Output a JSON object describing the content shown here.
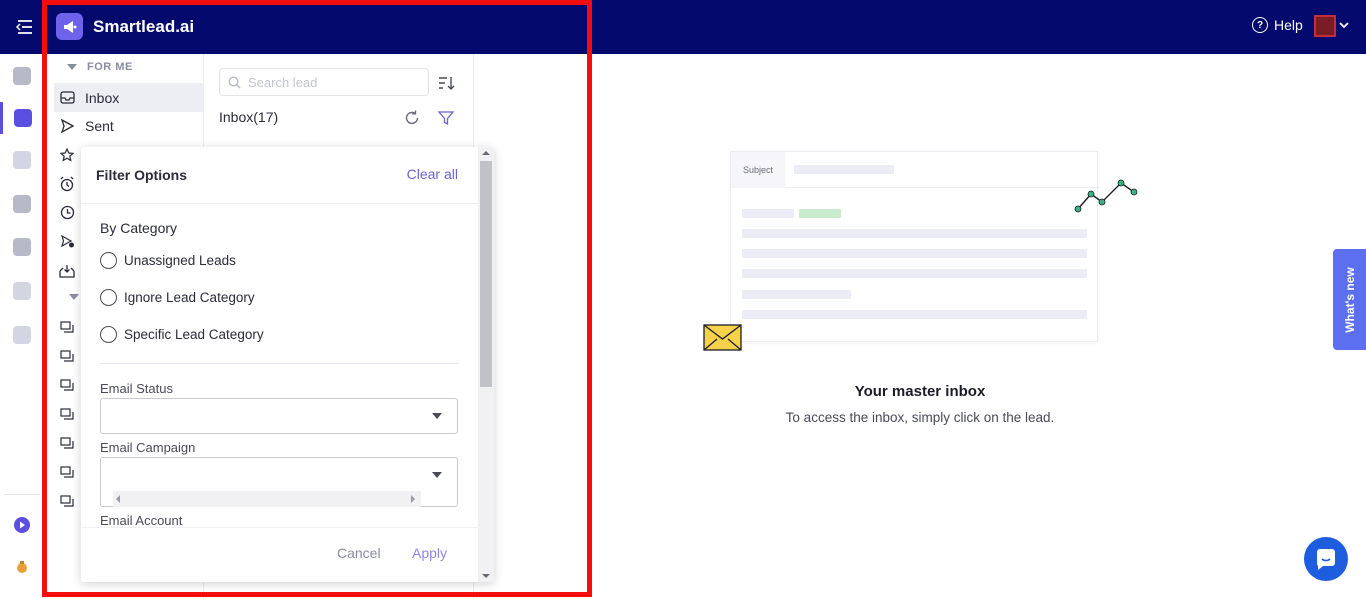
{
  "app": {
    "brand": "Smartlead.ai"
  },
  "topbar": {
    "help_label": "Help"
  },
  "folders": {
    "section_label": "FOR ME",
    "items": [
      {
        "label": "Inbox",
        "icon": "inbox-icon"
      },
      {
        "label": "Sent",
        "icon": "send-icon"
      }
    ]
  },
  "list": {
    "search_placeholder": "Search lead",
    "inbox_title": "Inbox(17)"
  },
  "filter": {
    "title": "Filter Options",
    "clear_all": "Clear all",
    "by_category": "By Category",
    "categories": [
      "Unassigned Leads",
      "Ignore Lead Category",
      "Specific Lead Category"
    ],
    "email_status_label": "Email Status",
    "email_campaign_label": "Email Campaign",
    "email_account_label": "Email Account",
    "cancel": "Cancel",
    "apply": "Apply"
  },
  "main": {
    "subject_label": "Subject",
    "empty_title": "Your master inbox",
    "empty_subtitle": "To access the inbox, simply click on the lead."
  },
  "whats_new": "What's new",
  "colors": {
    "topbar": "#040a6d",
    "accent": "#5a4fe0",
    "highlight_frame": "#f40d0d"
  }
}
